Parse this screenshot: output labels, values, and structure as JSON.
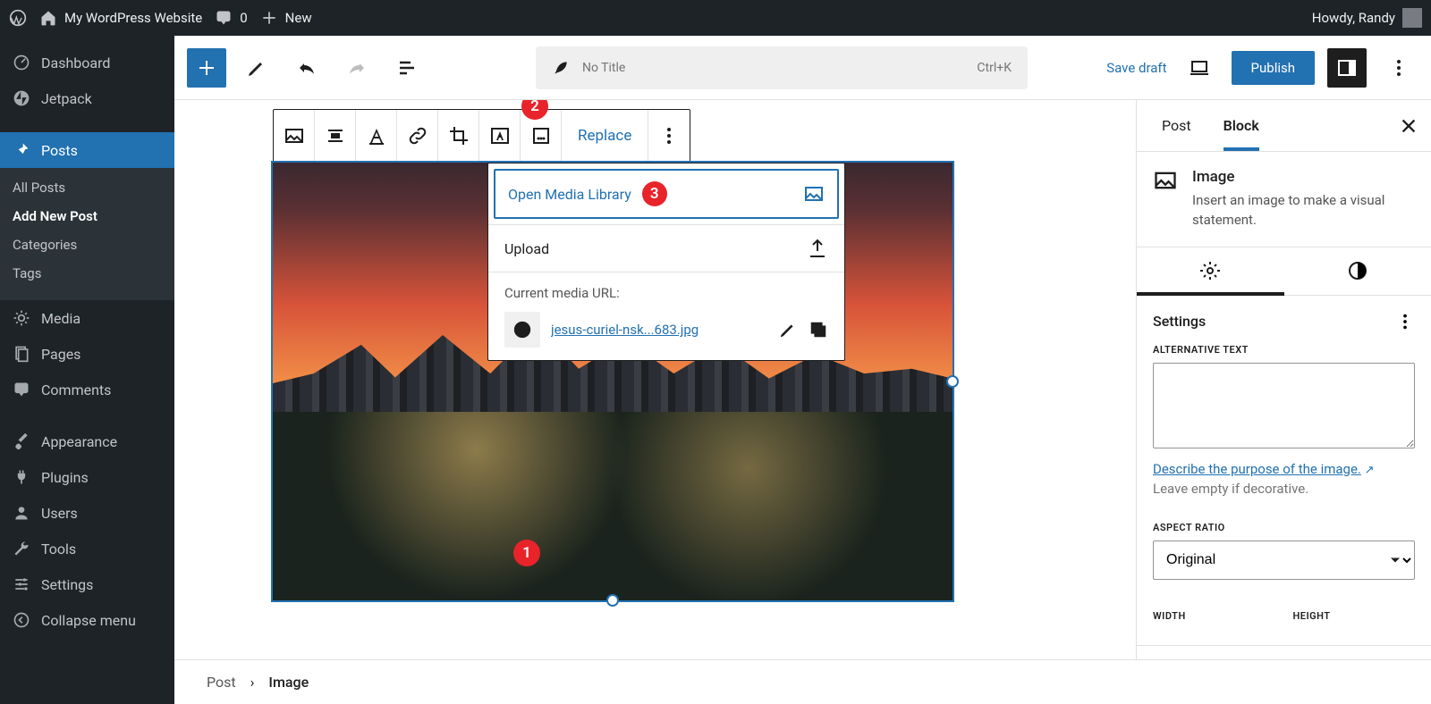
{
  "adminbar": {
    "site": "My WordPress Website",
    "comments": "0",
    "new": "New",
    "howdy": "Howdy, Randy"
  },
  "sidebar": {
    "dashboard": "Dashboard",
    "jetpack": "Jetpack",
    "posts": "Posts",
    "sub": {
      "all": "All Posts",
      "add": "Add New Post",
      "categories": "Categories",
      "tags": "Tags"
    },
    "media": "Media",
    "pages": "Pages",
    "comments": "Comments",
    "appearance": "Appearance",
    "plugins": "Plugins",
    "users": "Users",
    "tools": "Tools",
    "settings": "Settings",
    "collapse": "Collapse menu"
  },
  "editorTop": {
    "title": "No Title",
    "shortcut": "Ctrl+K",
    "saveDraft": "Save draft",
    "publish": "Publish"
  },
  "blockToolbar": {
    "replace": "Replace"
  },
  "replaceDropdown": {
    "open": "Open Media Library",
    "upload": "Upload",
    "currentLabel": "Current media URL:",
    "filename": "jesus-curiel-nsk...683.jpg"
  },
  "settingsPanel": {
    "postTab": "Post",
    "blockTab": "Block",
    "blockName": "Image",
    "blockDesc": "Insert an image to make a visual statement.",
    "settingsHeading": "Settings",
    "altLabel": "ALTERNATIVE TEXT",
    "altHelpLink": "Describe the purpose of the image.",
    "altHelp2": "Leave empty if decorative.",
    "aspectLabel": "ASPECT RATIO",
    "aspectValue": "Original",
    "widthLabel": "WIDTH",
    "heightLabel": "HEIGHT"
  },
  "breadcrumb": {
    "post": "Post",
    "current": "Image"
  },
  "badges": {
    "b1": "1",
    "b2": "2",
    "b3": "3"
  }
}
